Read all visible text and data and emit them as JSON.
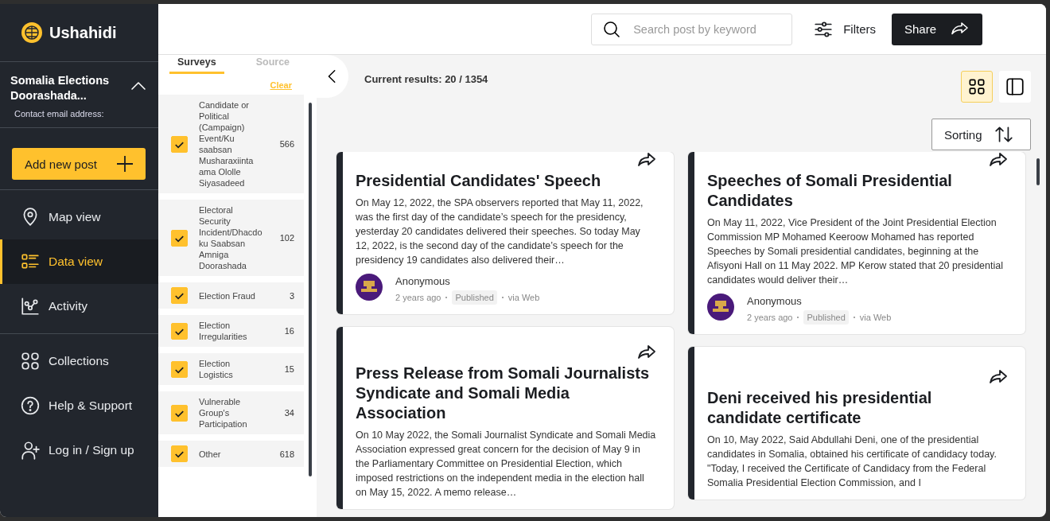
{
  "app": {
    "name": "Ushahidi"
  },
  "deployment": {
    "title": "Somalia Elections Doorashada...",
    "expanded": true,
    "contact_label": "Contact email address:"
  },
  "add_post_button": "Add new post",
  "nav_groups": [
    [
      {
        "kind": "map",
        "label": "Map view",
        "selected": false
      },
      {
        "kind": "data",
        "label": "Data view",
        "selected": true
      },
      {
        "kind": "activity",
        "label": "Activity",
        "selected": false
      }
    ],
    [
      {
        "kind": "collections",
        "label": "Collections",
        "selected": false
      },
      {
        "kind": "help",
        "label": "Help & Support",
        "selected": false
      },
      {
        "kind": "login",
        "label": "Log in / Sign up",
        "selected": false
      }
    ]
  ],
  "filters": {
    "tabs": [
      {
        "label": "Surveys",
        "selected": true
      },
      {
        "label": "Source",
        "selected": false
      }
    ],
    "clear": "Clear",
    "surveys": [
      {
        "label": "Candidate or Political (Campaign) Event/Ku saabsan Musharaxiinta ama Ololle Siyasadeed",
        "count": "566",
        "checked": true
      },
      {
        "label": "Electoral Security Incident/Dhacdo ku Saabsan Amniga Doorashada",
        "count": "102",
        "checked": true
      },
      {
        "label": "Election Fraud",
        "count": "3",
        "checked": true
      },
      {
        "label": "Election Irregularities",
        "count": "16",
        "checked": true
      },
      {
        "label": "Election Logistics",
        "count": "15",
        "checked": true
      },
      {
        "label": "Vulnerable Group's Participation",
        "count": "34",
        "checked": true
      },
      {
        "label": "Other",
        "count": "618",
        "checked": true
      }
    ]
  },
  "search": {
    "placeholder": "Search post by keyword"
  },
  "filters_button": "Filters",
  "share_button": "Share",
  "results": "Current results: 20 / 1354",
  "view_modes": [
    {
      "kind": "grid",
      "selected": true
    },
    {
      "kind": "list",
      "selected": false
    }
  ],
  "sorting_button": "Sorting",
  "posts": [
    {
      "title": "Presidential Candidates' Speech",
      "body": "On May 12, 2022, the SPA observers reported that May 11, 2022, was the first day of the candidate’s speech for the presidency, yesterday 20 candidates delivered their speeches. So today May 12, 2022, is the second day of the candidate’s speech for the presidency 19 candidates also delivered their…",
      "author": "Anonymous",
      "time": "2 years ago",
      "status": "Published",
      "source": "via Web"
    },
    {
      "title": "Speeches of Somali Presidential Candidates",
      "body": "On May 11, 2022, Vice President of the Joint Presidential Election Commission MP Mohamed Keeroow Mohamed has reported Speeches by Somali presidential candidates, beginning at the Afisyoni Hall on 11 May 2022. MP Kerow stated that 20 presidential candidates would deliver their…",
      "author": "Anonymous",
      "time": "2 years ago",
      "status": "Published",
      "source": "via Web"
    },
    {
      "title": "Press Release from Somali Journalists Syndicate and Somali Media Association",
      "body": "On 10 May 2022, the Somali Journalist Syndicate and Somali Media Association expressed great concern for the decision of May 9 in the Parliamentary Committee on Presidential Election, which imposed restrictions on the independent media in the election hall on May 15, 2022. A memo release…"
    },
    {
      "title": "Deni received his presidential candidate certificate",
      "body": "On 10, May 2022, Said Abdullahi Deni, one of the presidential candidates in Somalia, obtained his certificate of candidacy today. \"Today, I received the Certificate of Candidacy from the Federal Somalia Presidential Election Commission, and I"
    }
  ]
}
